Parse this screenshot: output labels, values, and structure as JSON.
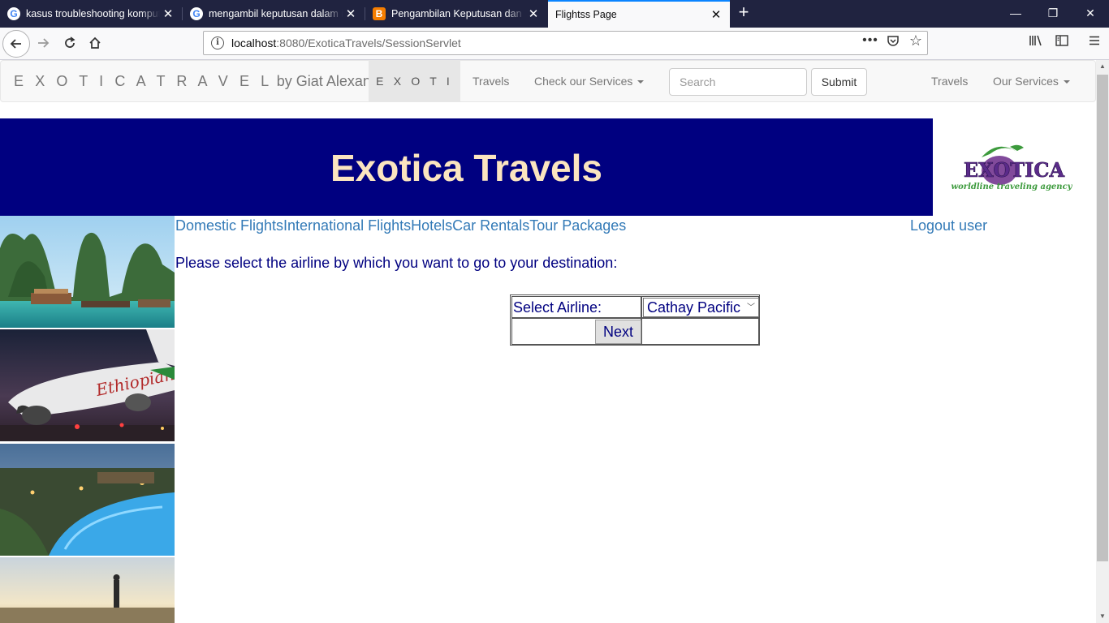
{
  "browser": {
    "tabs": [
      {
        "title": "kasus troubleshooting komputer",
        "icon": "google-favicon"
      },
      {
        "title": "mengambil keputusan dalam it",
        "icon": "google-favicon"
      },
      {
        "title": "Pengambilan Keputusan dan Pemecahan",
        "icon": "blogger-favicon"
      },
      {
        "title": "Flightss Page",
        "icon": "none"
      }
    ],
    "url_host": "localhost",
    "url_rest": ":8080/ExoticaTravels/SessionServlet"
  },
  "site_nav": {
    "brand_spaced": "E X O T I C A T R A V E L",
    "brand_rest": " by Giat Alexander Silaban",
    "active": "E X O T I C A",
    "travels": "Travels",
    "services": "Check our Services",
    "search_placeholder": "Search",
    "submit": "Submit",
    "right_travels": "Travels",
    "right_services": "Our Services"
  },
  "banner": {
    "title": "Exotica Travels",
    "logo_main": "EXOTICA",
    "logo_sub": "worldline traveling agency"
  },
  "menu": {
    "links": [
      "Domestic Flights",
      "International Flights",
      "Hotels",
      "Car Rentals",
      "Tour Packages"
    ],
    "logout": "Logout user"
  },
  "form": {
    "prompt": "Please select the airline by which you want to go to your destination:",
    "select_label": "Select Airline:",
    "selected_airline": "Cathay Pacific",
    "next": "Next"
  },
  "colors": {
    "banner_bg": "#000080",
    "banner_text": "#fbe5c0",
    "link": "#337ab7",
    "form_text": "#000080"
  }
}
